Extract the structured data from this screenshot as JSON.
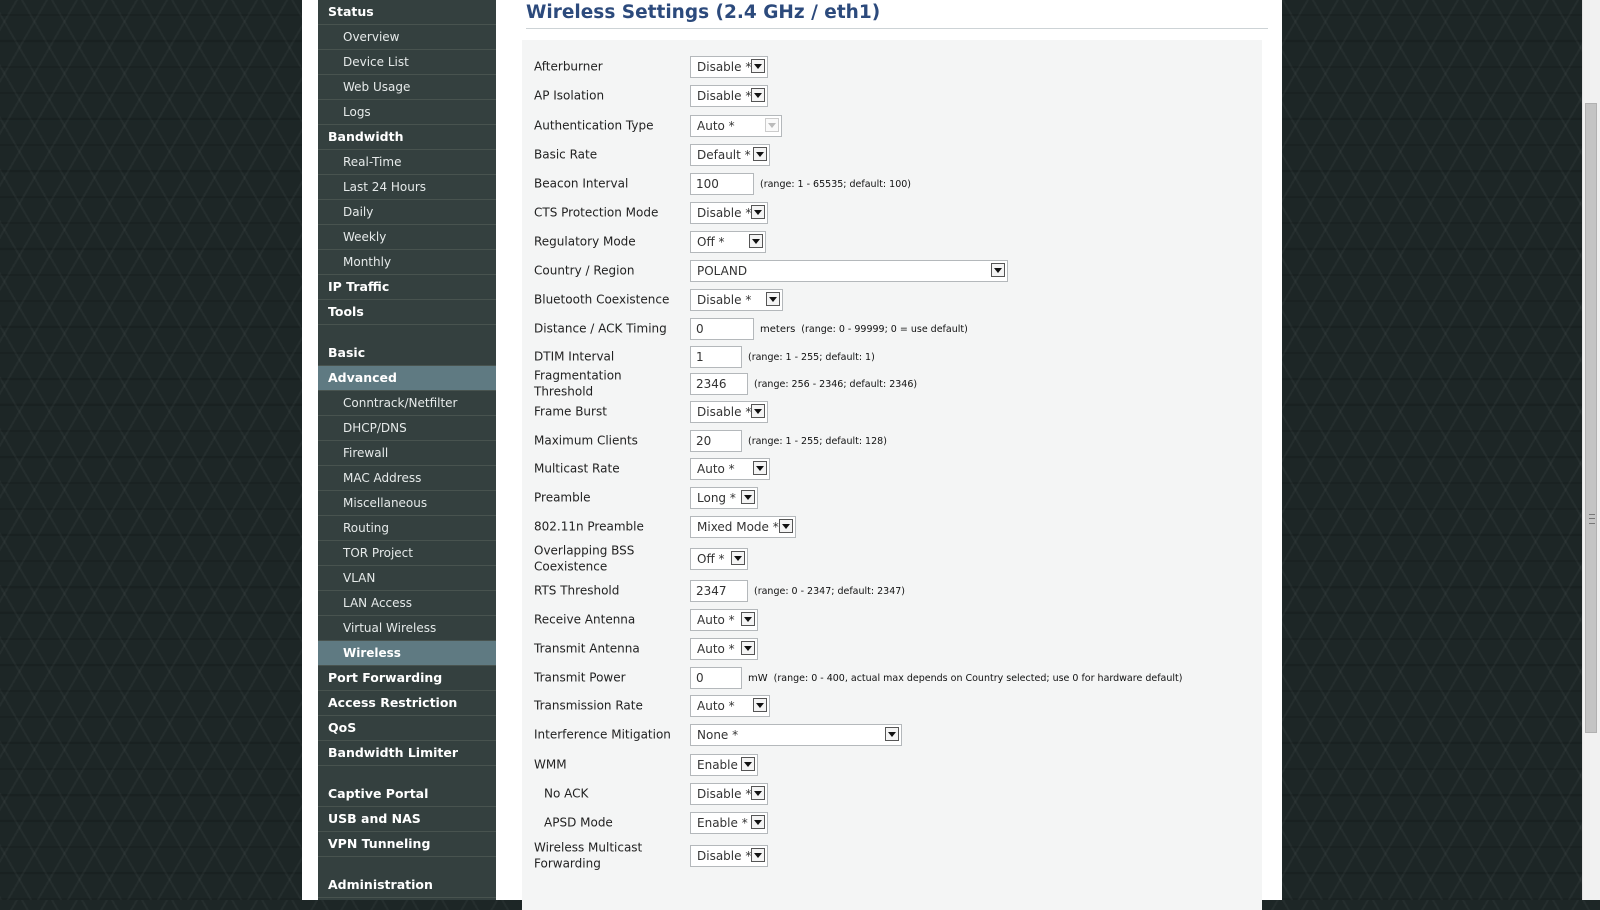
{
  "sidebar": {
    "items": [
      {
        "label": "Status",
        "kind": "header"
      },
      {
        "label": "Overview",
        "kind": "sub"
      },
      {
        "label": "Device List",
        "kind": "sub"
      },
      {
        "label": "Web Usage",
        "kind": "sub"
      },
      {
        "label": "Logs",
        "kind": "sub"
      },
      {
        "label": "Bandwidth",
        "kind": "header"
      },
      {
        "label": "Real-Time",
        "kind": "sub"
      },
      {
        "label": "Last 24 Hours",
        "kind": "sub"
      },
      {
        "label": "Daily",
        "kind": "sub"
      },
      {
        "label": "Weekly",
        "kind": "sub"
      },
      {
        "label": "Monthly",
        "kind": "sub"
      },
      {
        "label": "IP Traffic",
        "kind": "header"
      },
      {
        "label": "Tools",
        "kind": "header"
      },
      {
        "kind": "gap"
      },
      {
        "label": "Basic",
        "kind": "header"
      },
      {
        "label": "Advanced",
        "kind": "header",
        "active": true
      },
      {
        "label": "Conntrack/Netfilter",
        "kind": "sub"
      },
      {
        "label": "DHCP/DNS",
        "kind": "sub"
      },
      {
        "label": "Firewall",
        "kind": "sub"
      },
      {
        "label": "MAC Address",
        "kind": "sub"
      },
      {
        "label": "Miscellaneous",
        "kind": "sub"
      },
      {
        "label": "Routing",
        "kind": "sub"
      },
      {
        "label": "TOR Project",
        "kind": "sub"
      },
      {
        "label": "VLAN",
        "kind": "sub"
      },
      {
        "label": "LAN Access",
        "kind": "sub"
      },
      {
        "label": "Virtual Wireless",
        "kind": "sub"
      },
      {
        "label": "Wireless",
        "kind": "sub",
        "active": true
      },
      {
        "label": "Port Forwarding",
        "kind": "header"
      },
      {
        "label": "Access Restriction",
        "kind": "header"
      },
      {
        "label": "QoS",
        "kind": "header"
      },
      {
        "label": "Bandwidth Limiter",
        "kind": "header"
      },
      {
        "kind": "gap"
      },
      {
        "label": "Captive Portal",
        "kind": "header"
      },
      {
        "label": "USB and NAS",
        "kind": "header"
      },
      {
        "label": "VPN Tunneling",
        "kind": "header"
      },
      {
        "kind": "gap"
      },
      {
        "label": "Administration",
        "kind": "header"
      }
    ]
  },
  "main": {
    "title": "Wireless Settings (2.4 GHz / eth1)",
    "fields": [
      {
        "label": "Afterburner",
        "type": "select",
        "value": "Disable *"
      },
      {
        "label": "AP Isolation",
        "type": "select",
        "value": "Disable *"
      },
      {
        "label": "Authentication Type",
        "type": "select",
        "value": "Auto *",
        "disabled": true
      },
      {
        "label": "Basic Rate",
        "type": "select",
        "value": "Default *"
      },
      {
        "label": "Beacon Interval",
        "type": "text",
        "value": "100",
        "note": "(range: 1 - 65535; default: 100)"
      },
      {
        "label": "CTS Protection Mode",
        "type": "select",
        "value": "Disable *"
      },
      {
        "label": "Regulatory Mode",
        "type": "select",
        "value": "Off *"
      },
      {
        "label": "Country / Region",
        "type": "select",
        "value": "POLAND"
      },
      {
        "label": "Bluetooth Coexistence",
        "type": "select",
        "value": "Disable *"
      },
      {
        "label": "Distance / ACK Timing",
        "type": "text",
        "value": "0",
        "unit": "meters",
        "note": "(range: 0 - 99999; 0 = use default)"
      },
      {
        "label": "DTIM Interval",
        "type": "text",
        "value": "1",
        "note": "(range: 1 - 255; default: 1)"
      },
      {
        "label": "Fragmentation Threshold",
        "type": "text",
        "value": "2346",
        "note": "(range: 256 - 2346; default: 2346)"
      },
      {
        "label": "Frame Burst",
        "type": "select",
        "value": "Disable *"
      },
      {
        "label": "Maximum Clients",
        "type": "text",
        "value": "20",
        "note": "(range: 1 - 255; default: 128)"
      },
      {
        "label": "Multicast Rate",
        "type": "select",
        "value": "Auto *"
      },
      {
        "label": "Preamble",
        "type": "select",
        "value": "Long *"
      },
      {
        "label": "802.11n Preamble",
        "type": "select",
        "value": "Mixed Mode *"
      },
      {
        "label": "Overlapping BSS Coexistence",
        "type": "select",
        "value": "Off *"
      },
      {
        "label": "RTS Threshold",
        "type": "text",
        "value": "2347",
        "note": "(range: 0 - 2347; default: 2347)"
      },
      {
        "label": "Receive Antenna",
        "type": "select",
        "value": "Auto *"
      },
      {
        "label": "Transmit Antenna",
        "type": "select",
        "value": "Auto *"
      },
      {
        "label": "Transmit Power",
        "type": "text",
        "value": "0",
        "unit": "mW",
        "note": "(range: 0 - 400, actual max depends on Country selected; use 0 for hardware default)"
      },
      {
        "label": "Transmission Rate",
        "type": "select",
        "value": "Auto *"
      },
      {
        "label": "Interference Mitigation",
        "type": "select",
        "value": "None *"
      },
      {
        "label": "WMM",
        "type": "select",
        "value": "Enable"
      },
      {
        "label": "No ACK",
        "type": "select",
        "value": "Disable *",
        "indent": true
      },
      {
        "label": "APSD Mode",
        "type": "select",
        "value": "Enable *",
        "indent": true
      },
      {
        "label": "Wireless Multicast Forwarding",
        "type": "select",
        "value": "Disable *"
      }
    ]
  }
}
